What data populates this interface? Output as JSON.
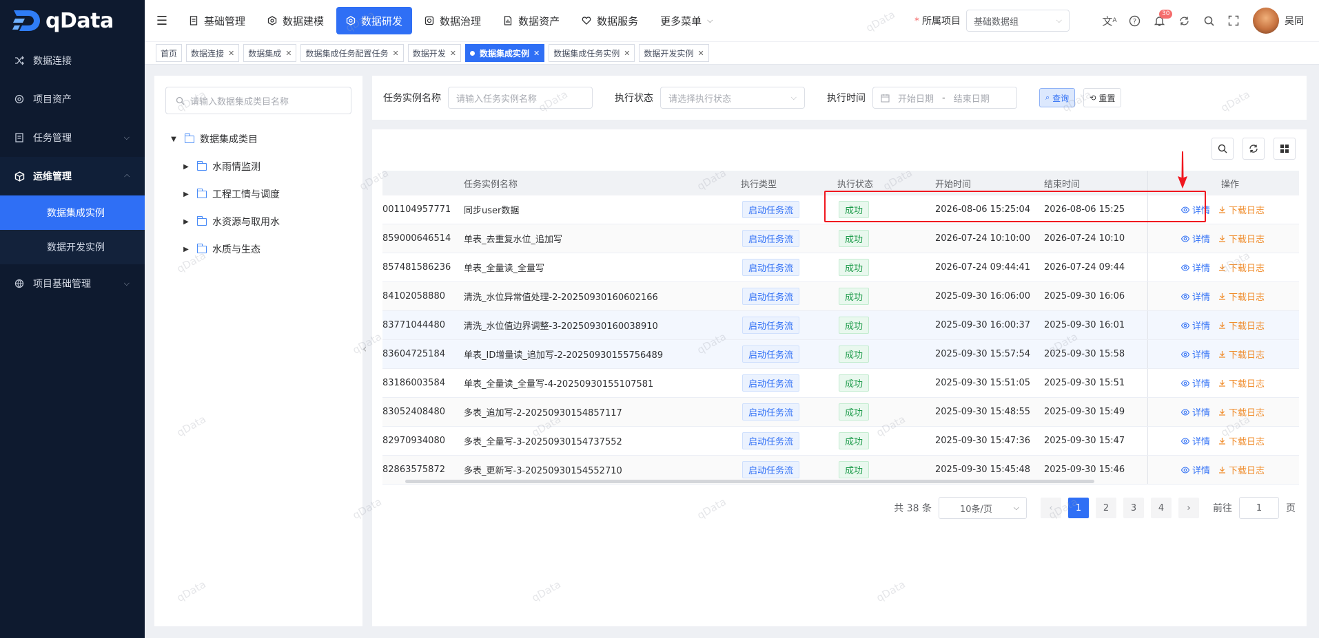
{
  "app": {
    "logo_text": "qData"
  },
  "sidebar": {
    "items": [
      {
        "label": "数据连接",
        "icon": "shuffle-icon"
      },
      {
        "label": "项目资产",
        "icon": "asset-icon"
      },
      {
        "label": "任务管理",
        "icon": "task-icon",
        "expandable": true
      },
      {
        "label": "运维管理",
        "icon": "cube-icon",
        "expandable": true,
        "open": true
      },
      {
        "label": "项目基础管理",
        "icon": "globe-icon",
        "expandable": true
      }
    ],
    "sub_items": [
      {
        "label": "数据集成实例",
        "active": true
      },
      {
        "label": "数据开发实例",
        "active": false
      }
    ]
  },
  "header": {
    "menu": [
      {
        "label": "基础管理",
        "icon": "doc-icon"
      },
      {
        "label": "数据建模",
        "icon": "hexagon-icon"
      },
      {
        "label": "数据研发",
        "icon": "hexagon-icon",
        "active": true
      },
      {
        "label": "数据治理",
        "icon": "governance-icon"
      },
      {
        "label": "数据资产",
        "icon": "asset-doc-icon"
      },
      {
        "label": "数据服务",
        "icon": "heart-icon"
      },
      {
        "label": "更多菜单",
        "icon": "chevron-down-icon"
      }
    ],
    "project_label": "所属项目",
    "project_required_mark": "*",
    "project_value": "基础数据组",
    "notification_count": "30",
    "username": "吴同"
  },
  "tabs": [
    {
      "label": "首页",
      "closable": false
    },
    {
      "label": "数据连接",
      "closable": true
    },
    {
      "label": "数据集成",
      "closable": true
    },
    {
      "label": "数据集成任务配置任务",
      "closable": true
    },
    {
      "label": "数据开发",
      "closable": true
    },
    {
      "label": "数据集成实例",
      "closable": true,
      "active": true
    },
    {
      "label": "数据集成任务实例",
      "closable": true
    },
    {
      "label": "数据开发实例",
      "closable": true
    }
  ],
  "tree": {
    "search_placeholder": "请输入数据集成类目名称",
    "root": "数据集成类目",
    "children": [
      "水雨情监测",
      "工程工情与调度",
      "水资源与取用水",
      "水质与生态"
    ]
  },
  "filters": {
    "name_label": "任务实例名称",
    "name_placeholder": "请输入任务实例名称",
    "status_label": "执行状态",
    "status_placeholder": "请选择执行状态",
    "time_label": "执行时间",
    "start_placeholder": "开始日期",
    "range_sep": "-",
    "end_placeholder": "结束日期",
    "query_label": "查询",
    "reset_label": "重置"
  },
  "table": {
    "columns": [
      "",
      "任务实例名称",
      "执行类型",
      "执行状态",
      "开始时间",
      "结束时间",
      "操作"
    ],
    "detail_label": "详情",
    "log_label": "下载日志",
    "rows": [
      {
        "id": "001104957771",
        "name": "同步user数据",
        "type": "启动任务流",
        "status": "成功",
        "start": "2026-08-06 15:25:04",
        "end": "2026-08-06 15:25"
      },
      {
        "id": "859000646514",
        "name": "单表_去重复水位_追加写",
        "type": "启动任务流",
        "status": "成功",
        "start": "2026-07-24 10:10:00",
        "end": "2026-07-24 10:10"
      },
      {
        "id": "857481586236",
        "name": "单表_全量读_全量写",
        "type": "启动任务流",
        "status": "成功",
        "start": "2026-07-24 09:44:41",
        "end": "2026-07-24 09:44"
      },
      {
        "id": "84102058880",
        "name": "清洗_水位异常值处理-2-20250930160602166",
        "type": "启动任务流",
        "status": "成功",
        "start": "2025-09-30 16:06:00",
        "end": "2025-09-30 16:06"
      },
      {
        "id": "83771044480",
        "name": "清洗_水位值边界调整-3-20250930160038910",
        "type": "启动任务流",
        "status": "成功",
        "start": "2025-09-30 16:00:37",
        "end": "2025-09-30 16:01"
      },
      {
        "id": "83604725184",
        "name": "单表_ID增量读_追加写-2-20250930155756489",
        "type": "启动任务流",
        "status": "成功",
        "start": "2025-09-30 15:57:54",
        "end": "2025-09-30 15:58"
      },
      {
        "id": "83186003584",
        "name": "单表_全量读_全量写-4-20250930155107581",
        "type": "启动任务流",
        "status": "成功",
        "start": "2025-09-30 15:51:05",
        "end": "2025-09-30 15:51"
      },
      {
        "id": "83052408480",
        "name": "多表_追加写-2-20250930154857117",
        "type": "启动任务流",
        "status": "成功",
        "start": "2025-09-30 15:48:55",
        "end": "2025-09-30 15:49"
      },
      {
        "id": "82970934080",
        "name": "多表_全量写-3-20250930154737552",
        "type": "启动任务流",
        "status": "成功",
        "start": "2025-09-30 15:47:36",
        "end": "2025-09-30 15:47"
      },
      {
        "id": "82863575872",
        "name": "多表_更新写-3-20250930154552710",
        "type": "启动任务流",
        "status": "成功",
        "start": "2025-09-30 15:45:48",
        "end": "2025-09-30 15:46"
      }
    ]
  },
  "pagination": {
    "total_text": "共 38 条",
    "page_size": "10条/页",
    "pages": [
      "1",
      "2",
      "3",
      "4"
    ],
    "current": "1",
    "goto_label": "前往",
    "goto_value": "1",
    "page_unit": "页"
  },
  "watermark": "qData",
  "colors": {
    "primary": "#2f6ff5",
    "sidebar_bg": "#0e1a2f",
    "success": "#1d9b4a",
    "warning": "#f08c2b",
    "annotation": "#f0171f"
  }
}
